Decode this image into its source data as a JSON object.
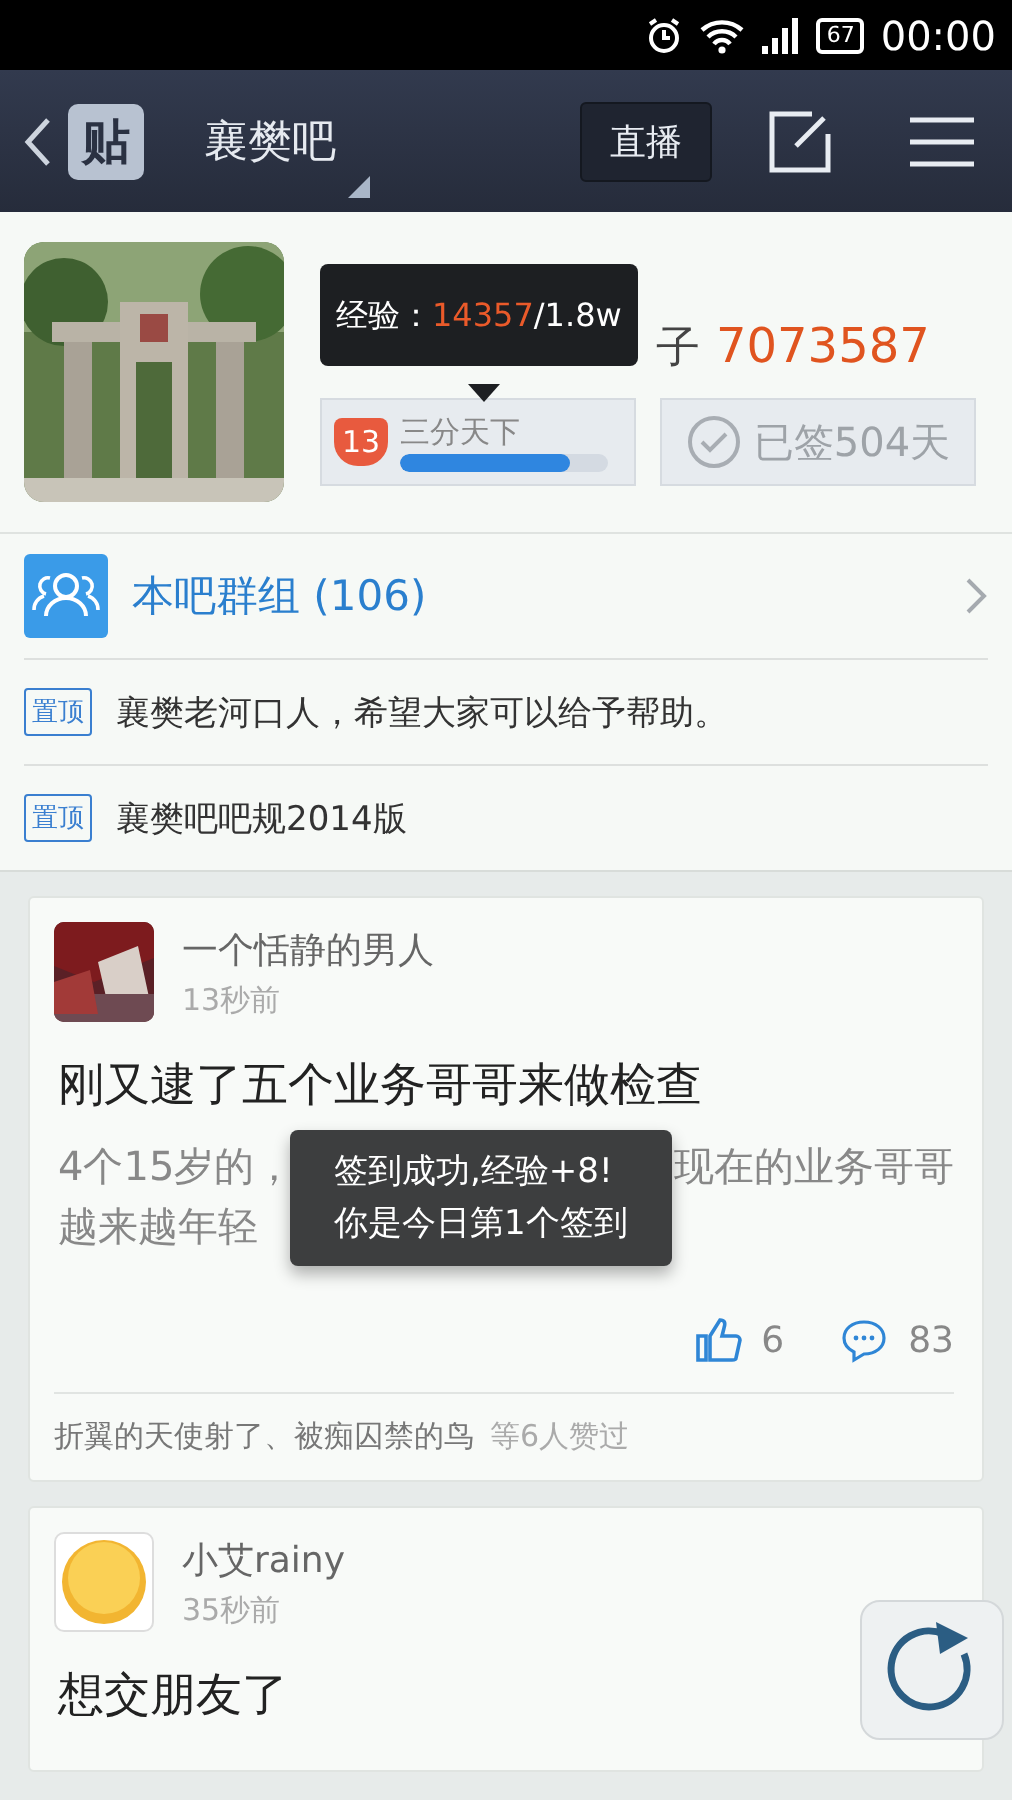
{
  "status_bar": {
    "battery": "67",
    "time": "00:00"
  },
  "nav": {
    "logo": "贴",
    "title": "襄樊吧",
    "live_button": "直播"
  },
  "forum": {
    "stats": [
      {
        "label": "子",
        "value": "7073587"
      }
    ],
    "level_badge": "13",
    "level_title": "三分天下",
    "level": 0.82,
    "signed": "已签504天",
    "tooltip": {
      "label": "经验：",
      "current": "14357",
      "total": "/1.8w"
    }
  },
  "group": {
    "label": "本吧群组 (106)"
  },
  "pinned": [
    {
      "tag": "置顶",
      "title": "襄樊老河口人，希望大家可以给予帮助。"
    },
    {
      "tag": "置顶",
      "title": "襄樊吧吧规2014版"
    }
  ],
  "posts": [
    {
      "avatar": {
        "kind": "picture"
      },
      "author": "一个恬静的男人",
      "time": "13秒前",
      "title": "刚又逮了五个业务哥哥来做检查",
      "body_lines": [
        [
          "4个15岁的，",
          "现在的业务哥哥"
        ],
        [
          "越来越年轻"
        ]
      ],
      "likes": "6",
      "comments": "83",
      "liked_by": "折翼的天使射了、被痴囚禁的鸟",
      "liked_count": "等6人赞过"
    },
    {
      "avatar": {
        "kind": "emoji"
      },
      "author": "小艾rainy",
      "time": "35秒前",
      "title": "想交朋友了"
    }
  ],
  "toast": [
    "签到成功,经验+8!",
    "你是今日第1个签到"
  ]
}
